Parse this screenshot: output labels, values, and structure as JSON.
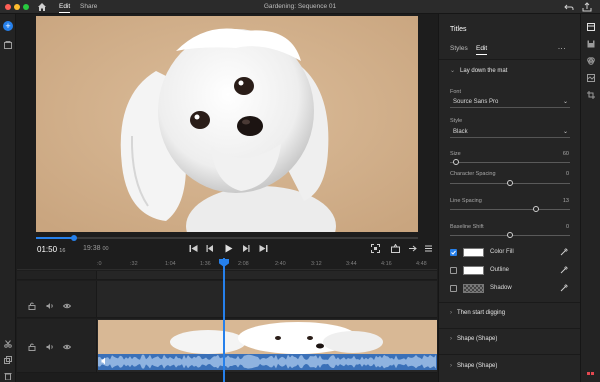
{
  "titlebar": {
    "tab_edit": "Edit",
    "tab_share": "Share",
    "window_title": "Gardening: Sequence 01"
  },
  "transport": {
    "timecode": "01:50",
    "timecode_frames": "16",
    "duration": "19:38",
    "duration_frames": "00"
  },
  "ruler": {
    "ticks": [
      ":0",
      ":32",
      "1:04",
      "1:36",
      "2:08",
      "2:40",
      "3:12",
      "3:44",
      "4:16",
      "4:48"
    ]
  },
  "progress": {
    "scrubber_fraction": 0.1,
    "playhead_time": "1:50"
  },
  "panel": {
    "title": "Titles",
    "tab_styles": "Styles",
    "tab_edit": "Edit",
    "more": "...",
    "section_title": "Lay down the mat",
    "font_label": "Font",
    "font_value": "Source Sans Pro",
    "style_label": "Style",
    "style_value": "Black",
    "size_label": "Size",
    "size_value": "60",
    "size_fraction": 0.05,
    "char_spacing_label": "Character Spacing",
    "char_spacing_value": "0",
    "char_spacing_fraction": 0.5,
    "line_spacing_label": "Line Spacing",
    "line_spacing_value": "13",
    "line_spacing_fraction": 0.72,
    "baseline_label": "Baseline Shift",
    "baseline_value": "0",
    "baseline_fraction": 0.5,
    "color_fill_label": "Color Fill",
    "color_fill_checked": true,
    "outline_label": "Outline",
    "outline_checked": false,
    "shadow_label": "Shadow",
    "shadow_checked": false,
    "section_2": "Then start digging",
    "section_3": "Shape (Shape)",
    "section_4": "Shape (Shape)"
  },
  "colors": {
    "accent": "#2680eb",
    "background_tan": "#d8b895",
    "audio_blue": "#3a70b8"
  }
}
